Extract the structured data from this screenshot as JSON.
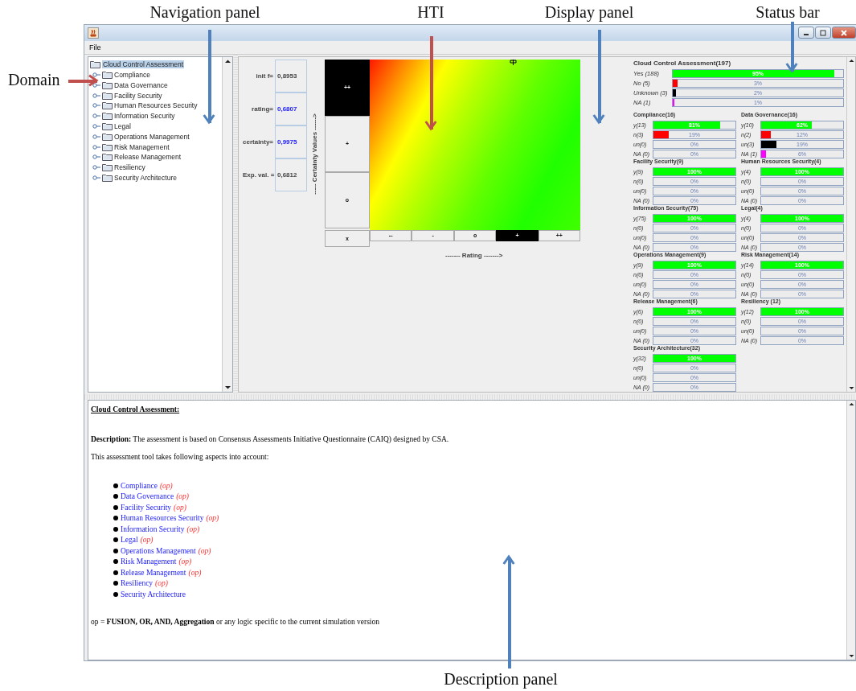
{
  "callouts": [
    {
      "label": "Navigation panel",
      "color": "#4f81bd"
    },
    {
      "label": "HTI",
      "color": "#c0504d"
    },
    {
      "label": "Display panel",
      "color": "#4f81bd"
    },
    {
      "label": "Status bar",
      "color": "#4f81bd"
    },
    {
      "label": "Domain",
      "color": "#c0504d"
    },
    {
      "label": "Description panel",
      "color": "#4f81bd"
    }
  ],
  "window": {
    "menu": [
      "File"
    ]
  },
  "tree": {
    "root": {
      "label": "Cloud Control Assessment",
      "selected": true
    },
    "children": [
      {
        "label": "Compliance"
      },
      {
        "label": "Data Governance"
      },
      {
        "label": "Facility Security"
      },
      {
        "label": "Human Resources Security"
      },
      {
        "label": "Information Security"
      },
      {
        "label": "Legal"
      },
      {
        "label": "Operations Management"
      },
      {
        "label": "Risk Management"
      },
      {
        "label": "Release Management"
      },
      {
        "label": "Resiliency"
      },
      {
        "label": "Security Architecture"
      }
    ]
  },
  "params": [
    {
      "label": "init f=",
      "value": "0,8953",
      "emphasis": false
    },
    {
      "label": "rating=",
      "value": "0,6807",
      "emphasis": true
    },
    {
      "label": "certainty=",
      "value": "0,9975",
      "emphasis": true
    },
    {
      "label": "Exp. val. =",
      "value": "0,6812",
      "emphasis": false
    }
  ],
  "hti": {
    "ylabel": "----- Certainty Values ------>",
    "xlabel": "------- Rating ------->",
    "rows": [
      {
        "label": "++",
        "selected": true
      },
      {
        "label": "+",
        "selected": false
      },
      {
        "label": "o",
        "selected": false
      }
    ],
    "clear": "x",
    "columns": [
      {
        "label": "--",
        "selected": false
      },
      {
        "label": "-",
        "selected": false
      },
      {
        "label": "o",
        "selected": false
      },
      {
        "label": "+",
        "selected": true
      },
      {
        "label": "++",
        "selected": false
      }
    ]
  },
  "status": {
    "title": "Cloud Control Assessment(197)",
    "rows": [
      {
        "label": "Yes (188)",
        "level": 0.95,
        "reading": "95%",
        "color": "#00ff00"
      },
      {
        "label": "No (5)",
        "level": 0.03,
        "reading": "3%",
        "color": "#ff0000"
      },
      {
        "label": "Unknown (3)",
        "level": 0.02,
        "reading": "2%",
        "color": "#000000"
      },
      {
        "label": "NA (1)",
        "level": 0.01,
        "reading": "1%",
        "color": "#ff00ff"
      }
    ],
    "groups": [
      {
        "title": "Compliance(16)",
        "rows": [
          {
            "label": "y(13)",
            "level": 0.81,
            "reading": "81%",
            "color": "#00ff00"
          },
          {
            "label": "n(3)",
            "level": 0.19,
            "reading": "19%",
            "color": "#ff0000"
          },
          {
            "label": "un(0)",
            "reading": "0%"
          },
          {
            "label": "NA (0)",
            "reading": "0%"
          }
        ]
      },
      {
        "title": "Data Governance(16)",
        "rows": [
          {
            "label": "y(10)",
            "level": 0.62,
            "reading": "62%",
            "color": "#00ff00"
          },
          {
            "label": "n(2)",
            "level": 0.12,
            "reading": "12%",
            "color": "#ff0000"
          },
          {
            "label": "un(3)",
            "level": 0.19,
            "reading": "19%",
            "color": "#000000"
          },
          {
            "label": "NA (1)",
            "level": 0.06,
            "reading": "6%",
            "color": "#ff00ff"
          }
        ]
      },
      {
        "title": "Facility Security(9)",
        "rows": [
          {
            "label": "y(9)",
            "level": 1,
            "reading": "100%",
            "color": "#00ff00"
          },
          {
            "label": "n(0)",
            "reading": "0%"
          },
          {
            "label": "un(0)",
            "reading": "0%"
          },
          {
            "label": "NA (0)",
            "reading": "0%"
          }
        ]
      },
      {
        "title": "Human Resources Security(4)",
        "rows": [
          {
            "label": "y(4)",
            "level": 1,
            "reading": "100%",
            "color": "#00ff00"
          },
          {
            "label": "n(0)",
            "reading": "0%"
          },
          {
            "label": "un(0)",
            "reading": "0%"
          },
          {
            "label": "NA (0)",
            "reading": "0%"
          }
        ]
      },
      {
        "title": "Information Security(75)",
        "rows": [
          {
            "label": "y(75)",
            "level": 1,
            "reading": "100%",
            "color": "#00ff00"
          },
          {
            "label": "n(0)",
            "reading": "0%"
          },
          {
            "label": "un(0)",
            "reading": "0%"
          },
          {
            "label": "NA (0)",
            "reading": "0%"
          }
        ]
      },
      {
        "title": "Legal(4)",
        "rows": [
          {
            "label": "y(4)",
            "level": 1,
            "reading": "100%",
            "color": "#00ff00"
          },
          {
            "label": "n(0)",
            "reading": "0%"
          },
          {
            "label": "un(0)",
            "reading": "0%"
          },
          {
            "label": "NA (0)",
            "reading": "0%"
          }
        ]
      },
      {
        "title": "Operations Management(9)",
        "rows": [
          {
            "label": "y(9)",
            "level": 1,
            "reading": "100%",
            "color": "#00ff00"
          },
          {
            "label": "n(0)",
            "reading": "0%"
          },
          {
            "label": "un(0)",
            "reading": "0%"
          },
          {
            "label": "NA (0)",
            "reading": "0%"
          }
        ]
      },
      {
        "title": "Risk Management(14)",
        "rows": [
          {
            "label": "y(14)",
            "level": 1,
            "reading": "100%",
            "color": "#00ff00"
          },
          {
            "label": "n(0)",
            "reading": "0%"
          },
          {
            "label": "un(0)",
            "reading": "0%"
          },
          {
            "label": "NA (0)",
            "reading": "0%"
          }
        ]
      },
      {
        "title": "Release Management(6)",
        "rows": [
          {
            "label": "y(6)",
            "level": 1,
            "reading": "100%",
            "color": "#00ff00"
          },
          {
            "label": "n(0)",
            "reading": "0%"
          },
          {
            "label": "un(0)",
            "reading": "0%"
          },
          {
            "label": "NA (0)",
            "reading": "0%"
          }
        ]
      },
      {
        "title": "Resiliency (12)",
        "rows": [
          {
            "label": "y(12)",
            "level": 1,
            "reading": "100%",
            "color": "#00ff00"
          },
          {
            "label": "n(0)",
            "reading": "0%"
          },
          {
            "label": "un(0)",
            "reading": "0%"
          },
          {
            "label": "NA (0)",
            "reading": "0%"
          }
        ]
      },
      {
        "title": "Security Architecture(32)",
        "rows": [
          {
            "label": "y(32)",
            "level": 1,
            "reading": "100%",
            "color": "#00ff00"
          },
          {
            "label": "n(0)",
            "reading": "0%"
          },
          {
            "label": "un(0)",
            "reading": "0%"
          },
          {
            "label": "NA (0)",
            "reading": "0%"
          }
        ]
      }
    ]
  },
  "description": {
    "title": "Cloud Control Assessment:",
    "text": "**Description:** The assessment is based on Consensus Assessments Initiative Questionnaire (CAIQ) designed by CSA.",
    "intro": "This assessment tool takes following aspects into account:",
    "items": [
      {
        "label": "Compliance",
        "op": "(op)"
      },
      {
        "label": "Data Governance",
        "op": "(op)"
      },
      {
        "label": "Facility Security",
        "op": "(op)"
      },
      {
        "label": "Human Resources Security",
        "op": "(op)"
      },
      {
        "label": "Information Security",
        "op": "(op)"
      },
      {
        "label": "Legal",
        "op": "(op)"
      },
      {
        "label": "Operations Management",
        "op": "(op)"
      },
      {
        "label": "Risk Management",
        "op": "(op)"
      },
      {
        "label": "Release Management",
        "op": "(op)"
      },
      {
        "label": "Resiliency",
        "op": "(op)"
      },
      {
        "label": "Security Architecture"
      }
    ],
    "footer": "op = **FUSION, OR, AND, Aggregation** or any logic specific to the current simulation version"
  }
}
